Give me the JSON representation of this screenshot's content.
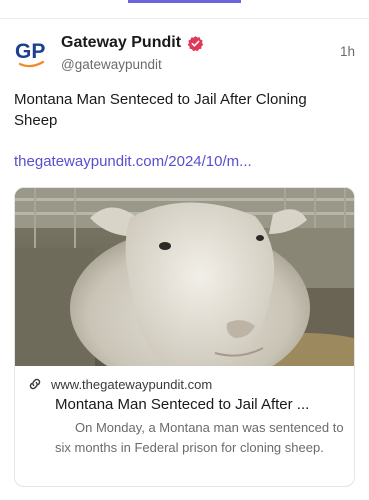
{
  "post": {
    "author_name": "Gateway Pundit",
    "author_handle": "@gatewaypundit",
    "avatar_text": "GP",
    "timestamp": "1h",
    "text": "Montana Man Senteced to Jail After Cloning Sheep",
    "link_text": "thegatewaypundit.com/2024/10/m..."
  },
  "card": {
    "domain": "www.thegatewaypundit.com",
    "title": "Montana Man Senteced to Jail After ...",
    "description": "On Monday, a Montana man was sentenced to six months in Federal prison for cloning sheep."
  },
  "icons": {
    "verified": "verified-badge-icon",
    "link": "link-icon"
  },
  "colors": {
    "accent": "#6e63d8",
    "link": "#5a4fcf",
    "verified": "#e0385b",
    "avatar_blue": "#1c3f8f",
    "avatar_orange": "#f08a24"
  }
}
